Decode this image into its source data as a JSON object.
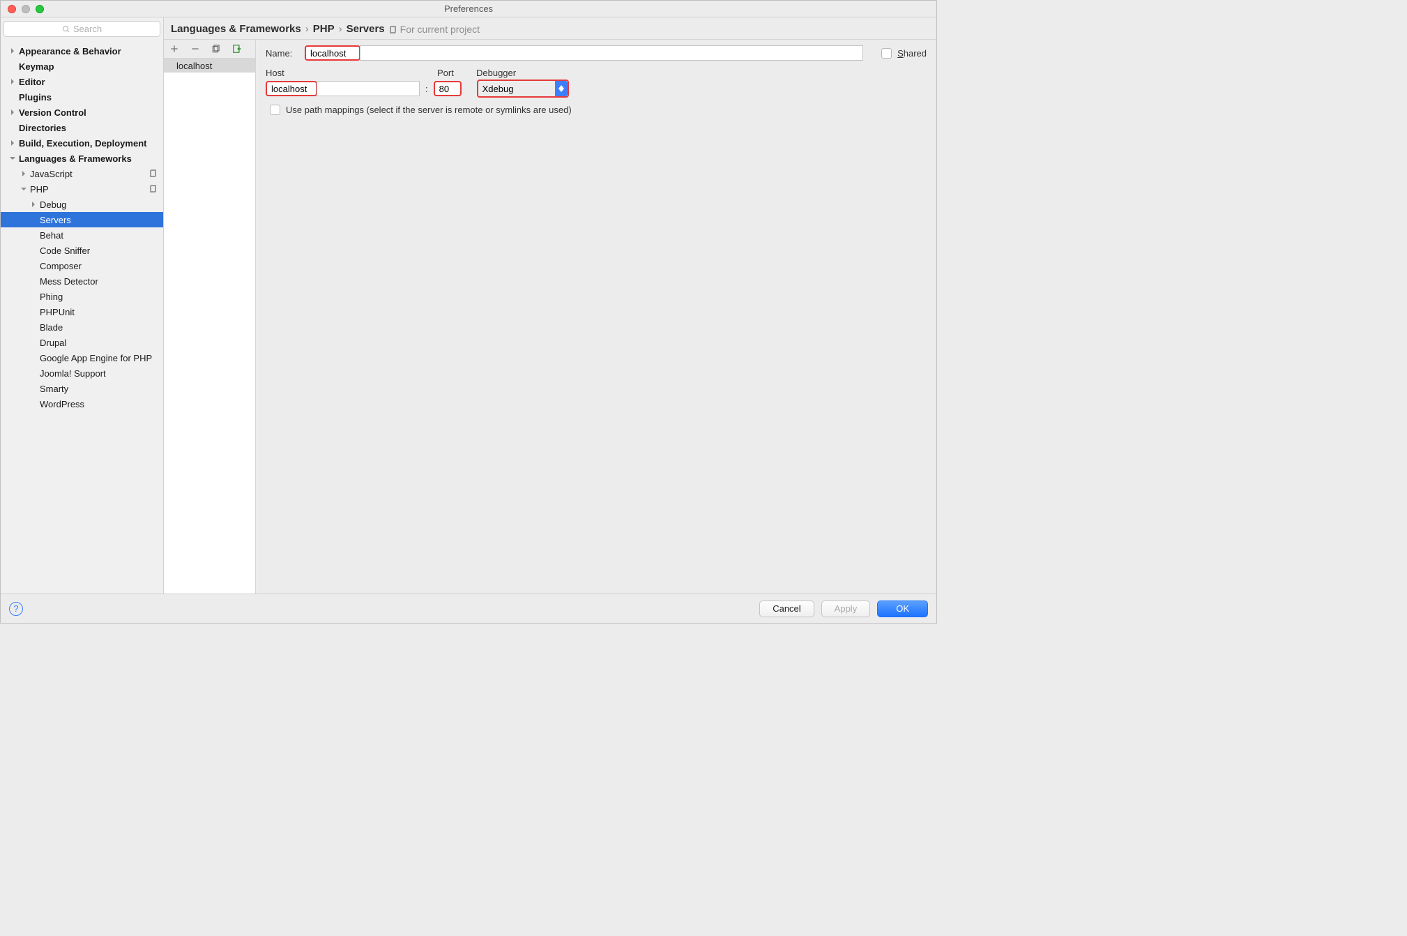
{
  "window": {
    "title": "Preferences"
  },
  "search": {
    "placeholder": "Search"
  },
  "sidebar": {
    "items": [
      {
        "label": "Appearance & Behavior",
        "bold": true,
        "indent": 12,
        "arrow": "right"
      },
      {
        "label": "Keymap",
        "bold": true,
        "indent": 26
      },
      {
        "label": "Editor",
        "bold": true,
        "indent": 12,
        "arrow": "right"
      },
      {
        "label": "Plugins",
        "bold": true,
        "indent": 26
      },
      {
        "label": "Version Control",
        "bold": true,
        "indent": 12,
        "arrow": "right"
      },
      {
        "label": "Directories",
        "bold": true,
        "indent": 26
      },
      {
        "label": "Build, Execution, Deployment",
        "bold": true,
        "indent": 12,
        "arrow": "right"
      },
      {
        "label": "Languages & Frameworks",
        "bold": true,
        "indent": 12,
        "arrow": "down"
      },
      {
        "label": "JavaScript",
        "indent": 28,
        "arrow": "right",
        "scope": true
      },
      {
        "label": "PHP",
        "indent": 28,
        "arrow": "down",
        "scope": true
      },
      {
        "label": "Debug",
        "indent": 42,
        "arrow": "right"
      },
      {
        "label": "Servers",
        "indent": 56,
        "selected": true
      },
      {
        "label": "Behat",
        "indent": 56
      },
      {
        "label": "Code Sniffer",
        "indent": 56
      },
      {
        "label": "Composer",
        "indent": 56
      },
      {
        "label": "Mess Detector",
        "indent": 56
      },
      {
        "label": "Phing",
        "indent": 56
      },
      {
        "label": "PHPUnit",
        "indent": 56
      },
      {
        "label": "Blade",
        "indent": 56
      },
      {
        "label": "Drupal",
        "indent": 56
      },
      {
        "label": "Google App Engine for PHP",
        "indent": 56
      },
      {
        "label": "Joomla! Support",
        "indent": 56
      },
      {
        "label": "Smarty",
        "indent": 56
      },
      {
        "label": "WordPress",
        "indent": 56
      }
    ]
  },
  "breadcrumb": {
    "part1": "Languages & Frameworks",
    "part2": "PHP",
    "part3": "Servers",
    "scope": "For current project"
  },
  "servers": {
    "items": [
      {
        "name": "localhost"
      }
    ]
  },
  "form": {
    "name_label": "Name:",
    "name_value": "localhost",
    "shared_label": "Shared",
    "host_label": "Host",
    "host_value": "localhost",
    "port_label": "Port",
    "port_value": "80",
    "debugger_label": "Debugger",
    "debugger_value": "Xdebug",
    "pathmap_label": "Use path mappings (select if the server is remote or symlinks are used)",
    "colon": ":"
  },
  "footer": {
    "cancel": "Cancel",
    "apply": "Apply",
    "ok": "OK"
  }
}
